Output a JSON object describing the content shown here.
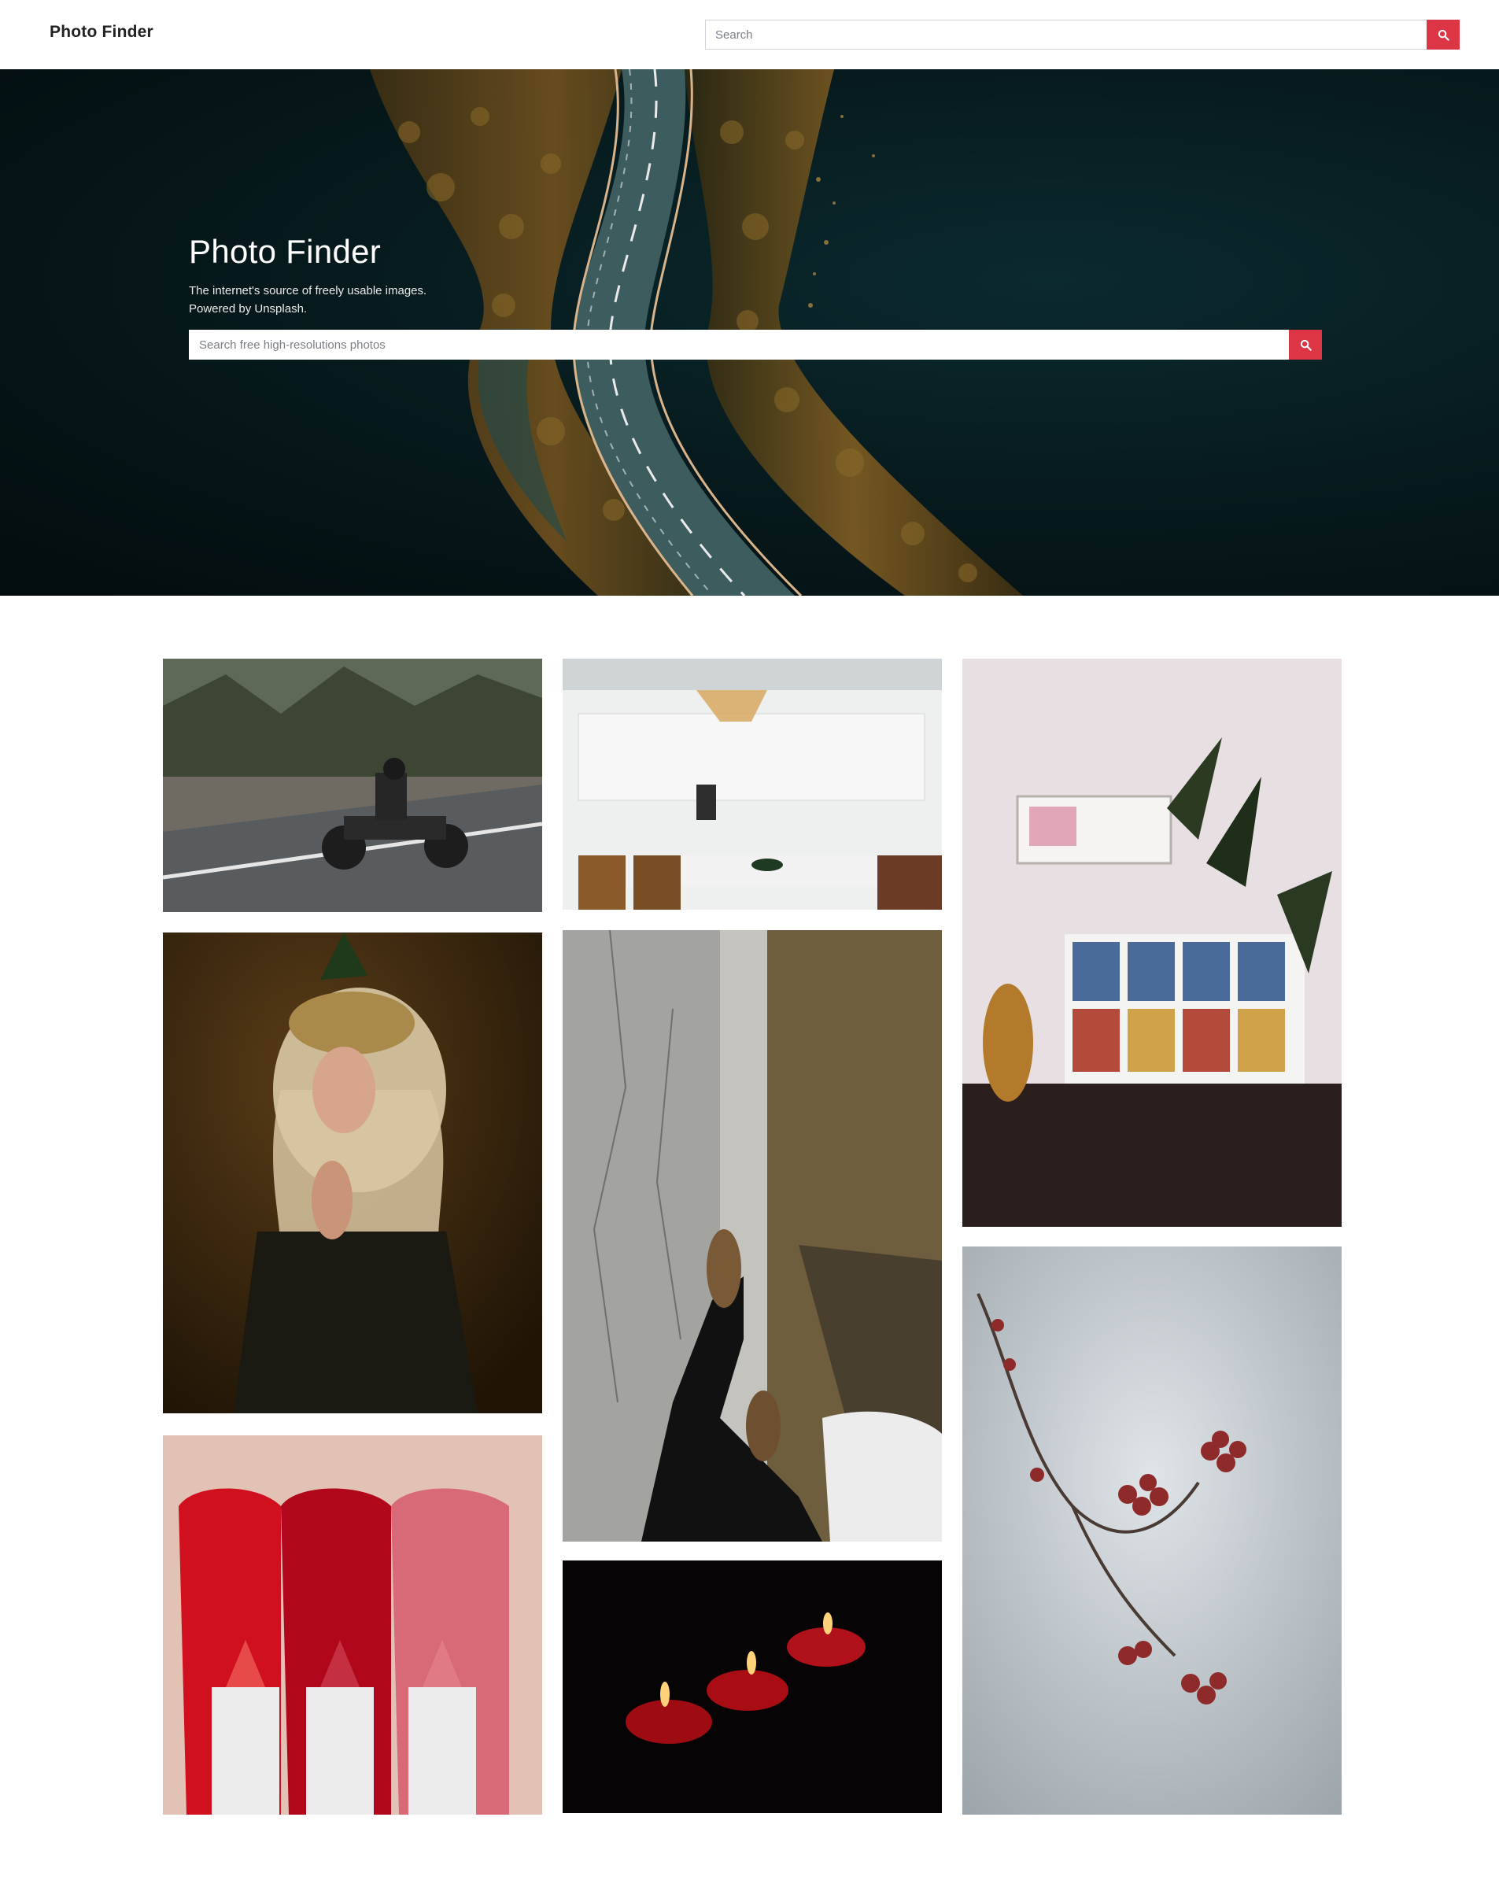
{
  "navbar": {
    "brand": "Photo Finder",
    "search_placeholder": "Search",
    "search_icon": "search-icon"
  },
  "hero": {
    "title": "Photo Finder",
    "subtitle_line1": "The internet's source of freely usable images.",
    "subtitle_line2": "Powered by Unsplash.",
    "search_placeholder": "Search free high-resolutions photos",
    "search_icon": "search-icon",
    "background_image": "aerial-road-forest-photo"
  },
  "gallery": {
    "columns": [
      {
        "photos": [
          "motorcycle-rider-photo",
          "masquerade-mask-woman-photo",
          "lipstick-swatches-photo"
        ]
      },
      {
        "photos": [
          "white-kitchen-interior-photo",
          "walking-feet-sidewalk-photo",
          "red-candles-photo"
        ]
      },
      {
        "photos": [
          "bookshelf-plants-room-photo",
          "red-berries-branch-photo"
        ]
      }
    ]
  },
  "colors": {
    "accent": "#dc3545",
    "hero_bg": "#06181b"
  }
}
